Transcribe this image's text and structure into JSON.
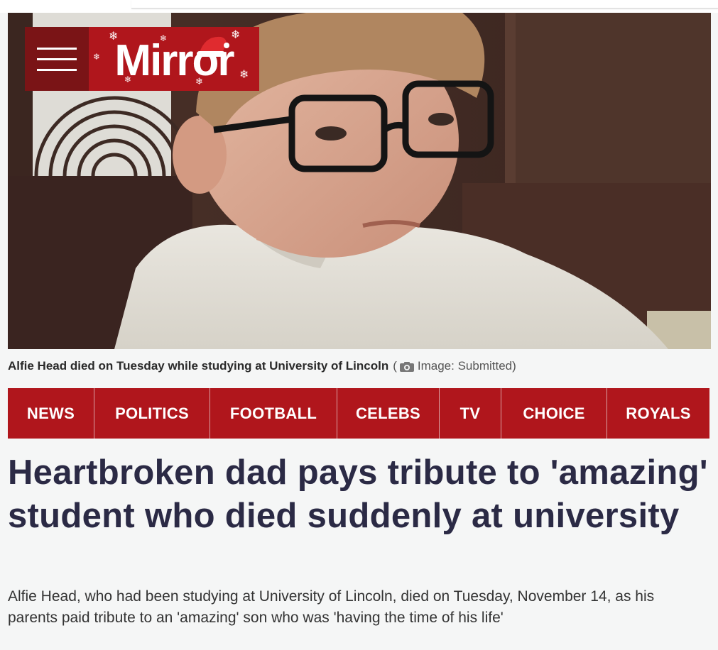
{
  "brand": {
    "name": "Mirror",
    "color": "#b0161c",
    "menu_color": "#7a1416"
  },
  "icons": {
    "menu": "hamburger-menu-icon",
    "camera": "camera-icon",
    "hat": "santa-hat-icon",
    "flake": "snowflake-icon"
  },
  "hero": {
    "alt": "Photo of a young man with glasses"
  },
  "caption": {
    "text": "Alfie Head died on Tuesday while studying at University of Lincoln",
    "open": "(",
    "credit": "Image: Submitted)"
  },
  "nav": {
    "items": [
      {
        "label": "NEWS"
      },
      {
        "label": "POLITICS"
      },
      {
        "label": "FOOTBALL"
      },
      {
        "label": "CELEBS"
      },
      {
        "label": "TV"
      },
      {
        "label": "CHOICE"
      },
      {
        "label": "ROYALS"
      }
    ]
  },
  "article": {
    "headline": "Heartbroken dad pays tribute to 'amazing' student who died suddenly at university",
    "standfirst": "Alfie Head, who had been studying at University of Lincoln, died on Tuesday, November 14, as his parents paid tribute to an 'amazing' son who was 'having the time of his life'"
  }
}
